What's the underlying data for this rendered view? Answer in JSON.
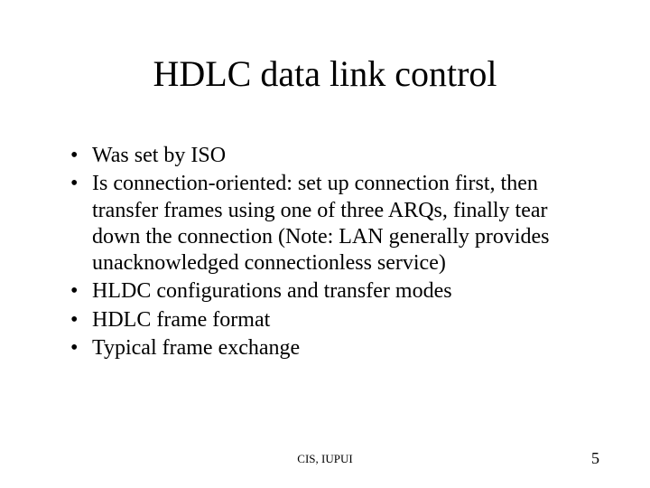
{
  "title": "HDLC data link control",
  "bullets": [
    "Was set by ISO",
    "Is connection-oriented: set up connection first, then transfer frames using one of three ARQs, finally tear down the connection (Note: LAN generally provides unacknowledged connectionless service)",
    "HLDC configurations and transfer modes",
    "HDLC frame format",
    "Typical frame exchange"
  ],
  "footer": {
    "center": "CIS, IUPUI",
    "pageNumber": "5"
  }
}
